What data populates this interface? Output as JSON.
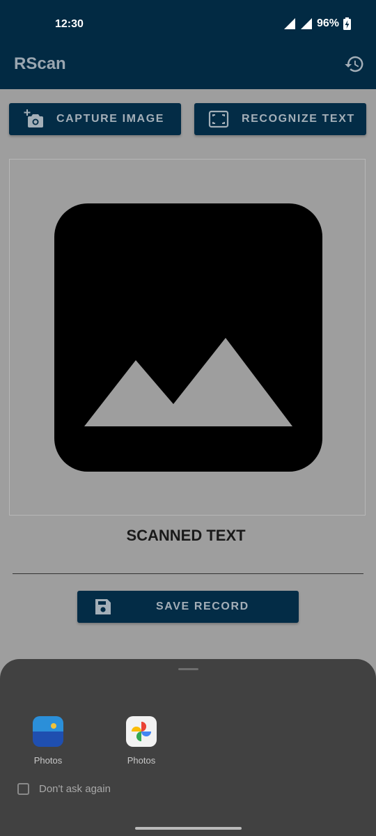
{
  "status_bar": {
    "time": "12:30",
    "battery": "96%",
    "icons": [
      "signal-icon",
      "signal-icon",
      "battery-charging-icon"
    ]
  },
  "app_bar": {
    "title": "RScan",
    "history_icon": "history-icon"
  },
  "toolbar": {
    "capture_label": "CAPTURE IMAGE",
    "capture_icon": "add-camera-icon",
    "recognize_label": "RECOGNIZE TEXT",
    "recognize_icon": "scan-frame-icon"
  },
  "image_preview": {
    "icon": "image-placeholder-icon"
  },
  "scanned": {
    "title": "SCANNED TEXT",
    "text": ""
  },
  "save": {
    "label": "SAVE RECORD",
    "icon": "save-icon"
  },
  "chooser": {
    "apps": [
      {
        "label": "Photos",
        "icon": "gallery-photos-icon"
      },
      {
        "label": "Photos",
        "icon": "google-photos-icon"
      }
    ],
    "dont_ask_label": "Don't ask again",
    "dont_ask_checked": false
  },
  "colors": {
    "primary": "#022a43",
    "button": "#032c46",
    "scrim_background": "#9e9e9e",
    "sheet": "#414141"
  }
}
